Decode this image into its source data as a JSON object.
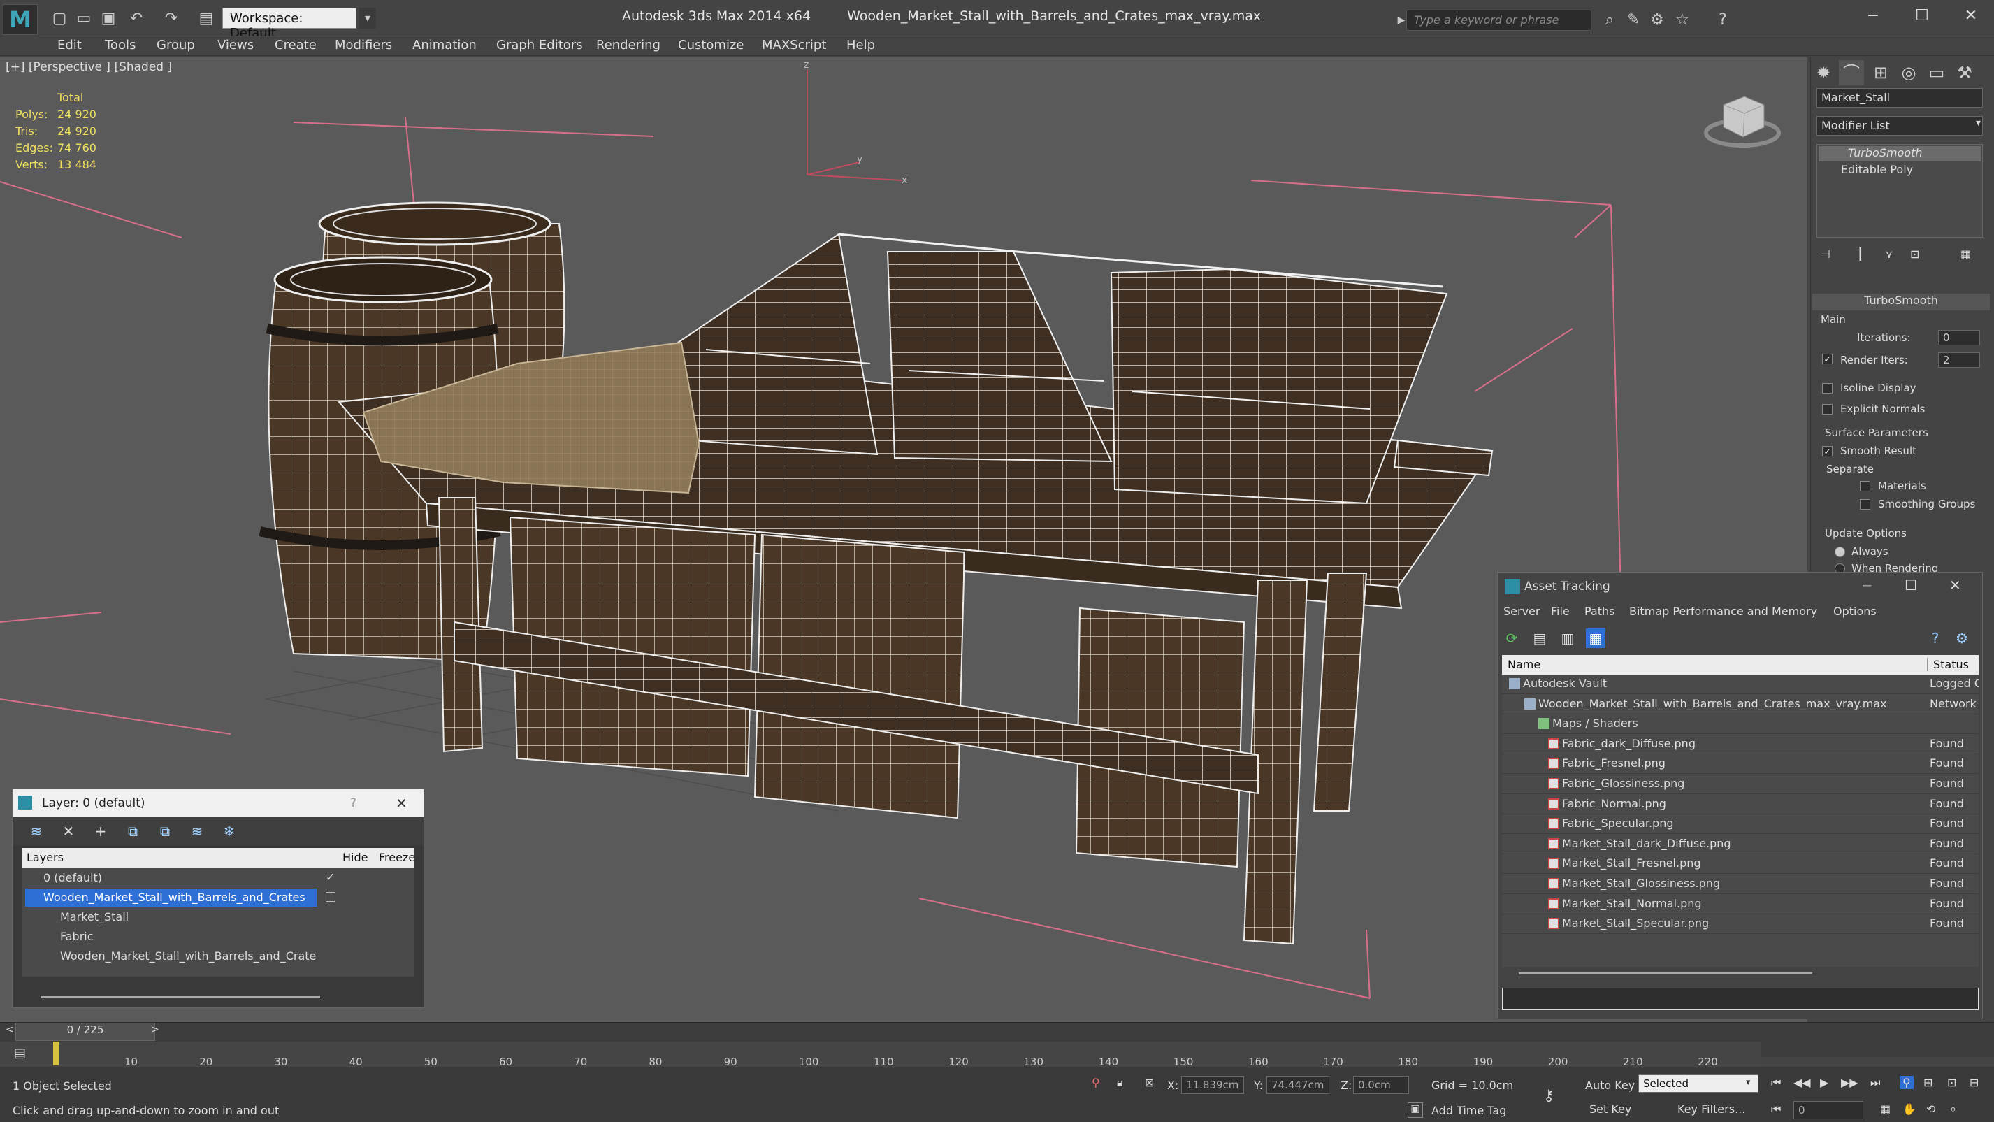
{
  "title_bar": {
    "app_title": "Autodesk 3ds Max  2014 x64",
    "file_title": "Wooden_Market_Stall_with_Barrels_and_Crates_max_vray.max",
    "workspace": "Workspace: Default",
    "search_placeholder": "Type a keyword or phrase"
  },
  "menu": [
    "Edit",
    "Tools",
    "Group",
    "Views",
    "Create",
    "Modifiers",
    "Animation",
    "Graph Editors",
    "Rendering",
    "Customize",
    "MAXScript",
    "Help"
  ],
  "viewport": {
    "label": "[+] [Perspective ] [Shaded ]",
    "stats_header": "Total",
    "stats": [
      {
        "label": "Polys:",
        "value": "24 920"
      },
      {
        "label": "Tris:",
        "value": "24 920"
      },
      {
        "label": "Edges:",
        "value": "74 760"
      },
      {
        "label": "Verts:",
        "value": "13 484"
      }
    ],
    "axis": {
      "z": "z",
      "y": "y",
      "x": "x"
    }
  },
  "command_panel": {
    "object_name": "Market_Stall",
    "modifier_list": "Modifier List",
    "stack": [
      "TurboSmooth",
      "Editable Poly"
    ],
    "rollout_title": "TurboSmooth",
    "main_label": "Main",
    "iterations_label": "Iterations:",
    "iterations_value": "0",
    "render_iters_label": "Render Iters:",
    "render_iters_value": "2",
    "isoline_display": "Isoline Display",
    "explicit_normals": "Explicit Normals",
    "surface_parameters": "Surface Parameters",
    "smooth_result": "Smooth Result",
    "separate": "Separate",
    "materials": "Materials",
    "smoothing_groups": "Smoothing Groups",
    "update_options": "Update Options",
    "always": "Always",
    "when_rendering": "When Rendering"
  },
  "layer_window": {
    "title": "Layer: 0 (default)",
    "help": "?",
    "col_layers": "Layers",
    "col_hide": "Hide",
    "col_freeze": "Freeze",
    "rows": [
      {
        "name": "0 (default)",
        "selected": false
      },
      {
        "name": "Wooden_Market_Stall_with_Barrels_and_Crates",
        "selected": true
      },
      {
        "name": "Market_Stall",
        "selected": false
      },
      {
        "name": "Fabric",
        "selected": false
      },
      {
        "name": "Wooden_Market_Stall_with_Barrels_and_Crate",
        "selected": false
      }
    ]
  },
  "asset_window": {
    "title": "Asset Tracking",
    "menu": [
      "Server",
      "File",
      "Paths",
      "Bitmap Performance and Memory",
      "Options"
    ],
    "col_name": "Name",
    "col_status": "Status",
    "rows": [
      {
        "name": "Autodesk Vault",
        "status": "Logged O"
      },
      {
        "name": "Wooden_Market_Stall_with_Barrels_and_Crates_max_vray.max",
        "status": "Network I"
      },
      {
        "name": "Maps / Shaders",
        "status": ""
      },
      {
        "name": "Fabric_dark_Diffuse.png",
        "status": "Found"
      },
      {
        "name": "Fabric_Fresnel.png",
        "status": "Found"
      },
      {
        "name": "Fabric_Glossiness.png",
        "status": "Found"
      },
      {
        "name": "Fabric_Normal.png",
        "status": "Found"
      },
      {
        "name": "Fabric_Specular.png",
        "status": "Found"
      },
      {
        "name": "Market_Stall_dark_Diffuse.png",
        "status": "Found"
      },
      {
        "name": "Market_Stall_Fresnel.png",
        "status": "Found"
      },
      {
        "name": "Market_Stall_Glossiness.png",
        "status": "Found"
      },
      {
        "name": "Market_Stall_Normal.png",
        "status": "Found"
      },
      {
        "name": "Market_Stall_Specular.png",
        "status": "Found"
      }
    ]
  },
  "timeline": {
    "frame": "0 / 225",
    "ticks": [
      "10",
      "20",
      "30",
      "40",
      "50",
      "60",
      "70",
      "80",
      "90",
      "100",
      "110",
      "120",
      "130",
      "140",
      "150",
      "160",
      "170",
      "180",
      "190",
      "200",
      "210",
      "220"
    ]
  },
  "status": {
    "selection": "1 Object Selected",
    "prompt": "Click and drag up-and-down to zoom in and out",
    "x_label": "X:",
    "x_value": "11.839cm",
    "y_label": "Y:",
    "y_value": "74.447cm",
    "z_label": "Z:",
    "z_value": "0.0cm",
    "grid": "Grid = 10.0cm",
    "auto_key": "Auto Key",
    "set_key": "Set Key",
    "selected": "Selected",
    "key_filters": "Key Filters...",
    "add_time_tag": "Add Time Tag",
    "frame_value": "0"
  },
  "colors": {
    "accent": "#3ea7b8",
    "selection": "#2e6fd6",
    "stats": "#f0e060",
    "wood": "#4a3726"
  }
}
